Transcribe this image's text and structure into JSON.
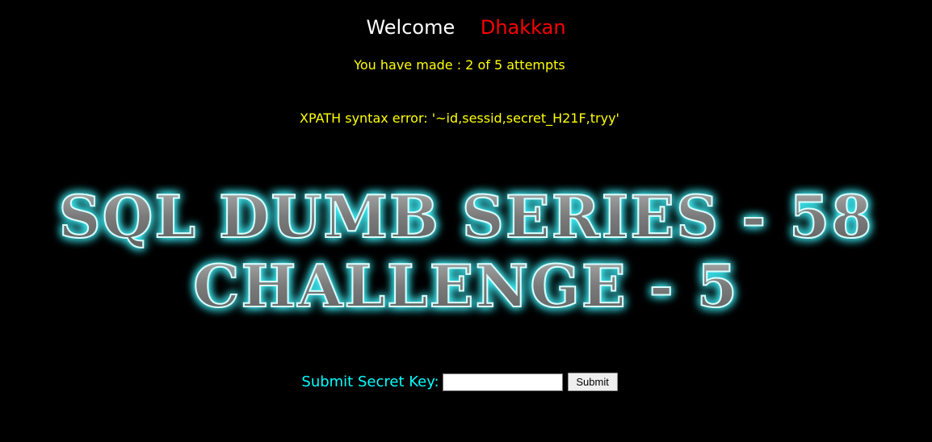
{
  "header": {
    "welcome_label": "Welcome",
    "user_name": "Dhakkan"
  },
  "status": {
    "attempts_text": "You have made : 2 of 5 attempts",
    "error_text": "XPATH syntax error: '~id,sessid,secret_H21F,tryy'"
  },
  "banner": {
    "line1": "SQL DUMB SERIES - 58",
    "line2": "CHALLENGE - 5",
    "glow_color": "#3ff6ff",
    "fill_color": "#8c8c8c"
  },
  "form": {
    "label": "Submit Secret Key:",
    "input_value": "",
    "submit_label": "Submit"
  },
  "colors": {
    "background": "#000000",
    "welcome": "#ffffff",
    "username": "#ff0000",
    "status": "#ffff00",
    "form_label": "#00ffff"
  }
}
